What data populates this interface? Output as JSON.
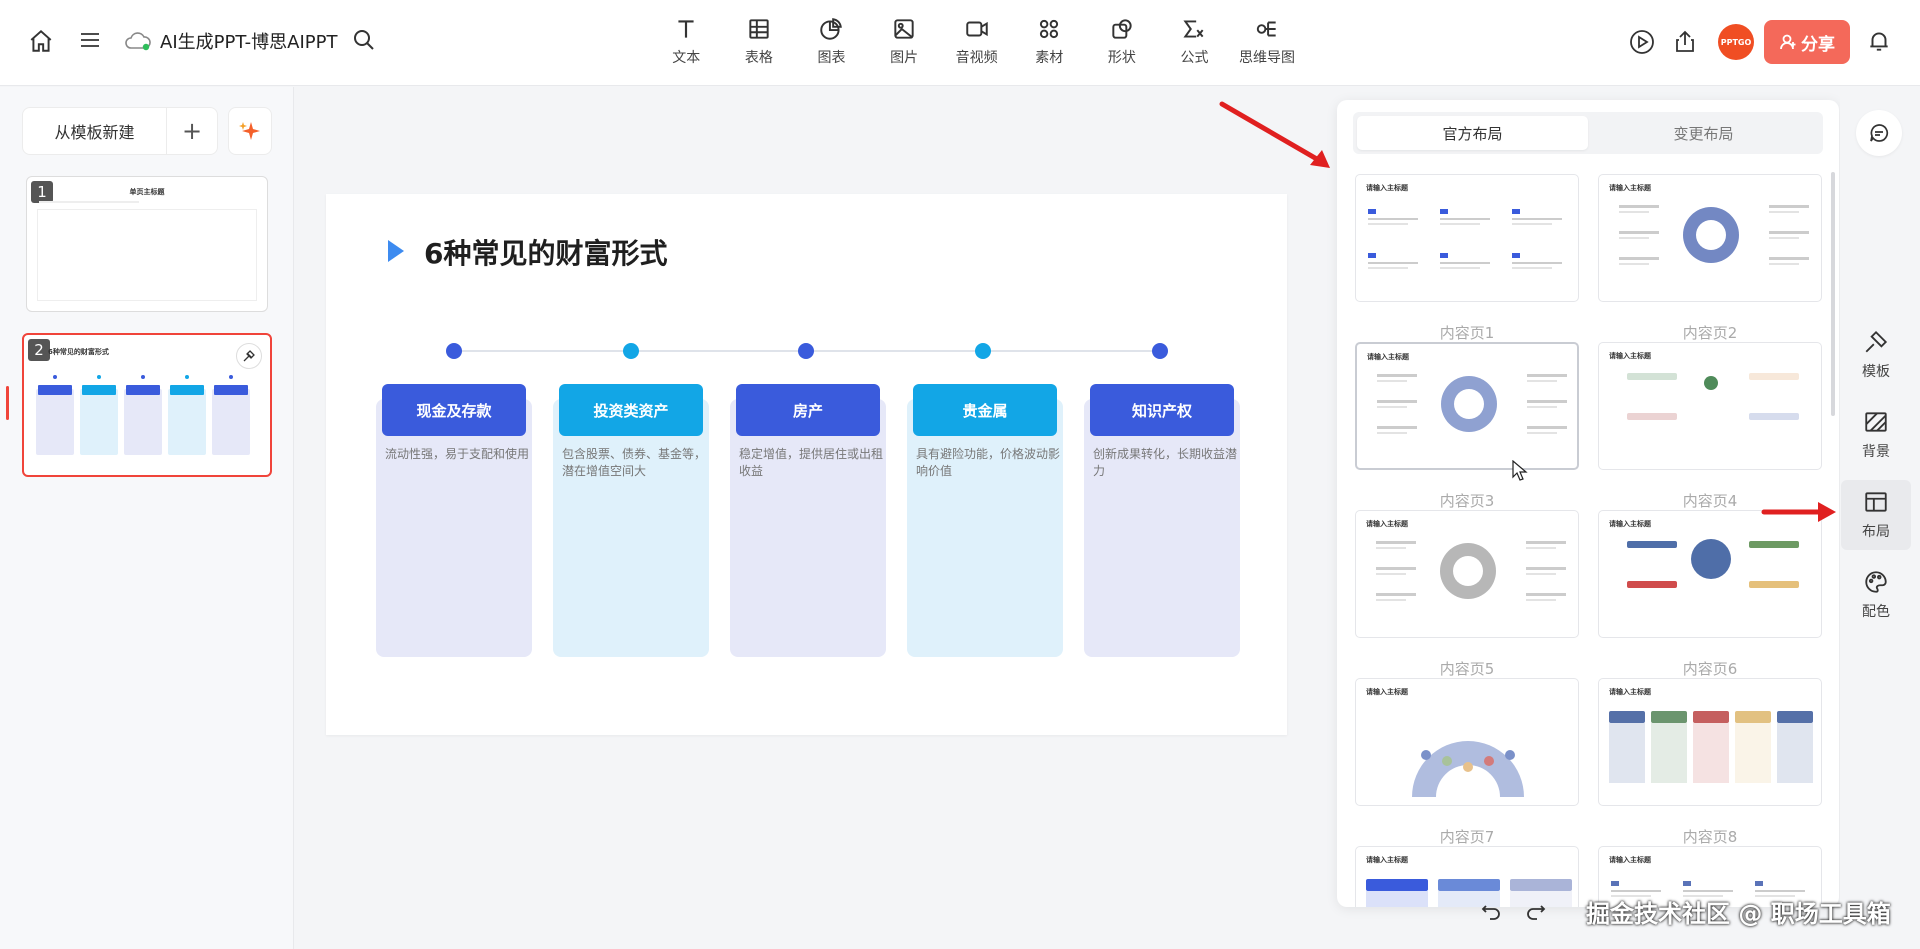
{
  "app": {
    "title": "AI生成PPT-博思AIPPT"
  },
  "toolbar": {
    "items": [
      {
        "label": "文本",
        "icon": "text-icon"
      },
      {
        "label": "表格",
        "icon": "table-icon"
      },
      {
        "label": "图表",
        "icon": "chart-icon"
      },
      {
        "label": "图片",
        "icon": "image-icon"
      },
      {
        "label": "音视频",
        "icon": "video-icon"
      },
      {
        "label": "素材",
        "icon": "material-icon"
      },
      {
        "label": "形状",
        "icon": "shape-icon"
      },
      {
        "label": "公式",
        "icon": "formula-icon"
      },
      {
        "label": "思维导图",
        "icon": "mindmap-icon"
      }
    ],
    "share_label": "分享",
    "avatar_text": "PPTGO"
  },
  "sidebar": {
    "new_from_template": "从模板新建",
    "plus": "+",
    "slides": [
      {
        "num": "1",
        "title": "单页主标题"
      },
      {
        "num": "2",
        "title": "6种常见的财富形式"
      }
    ]
  },
  "slide": {
    "title": "6种常见的财富形式",
    "accent": "#3d8bf0",
    "cards": [
      {
        "title": "现金及存款",
        "desc": "流动性强，易于支配和使用",
        "color": "#3a5bdc",
        "bg": "#e6e8f8"
      },
      {
        "title": "投资类资产",
        "desc": "包含股票、债券、基金等，潜在增值空间大",
        "color": "#12a6e6",
        "bg": "#dff1fb"
      },
      {
        "title": "房产",
        "desc": "稳定增值，提供居住或出租收益",
        "color": "#3a5bdc",
        "bg": "#e6e8f8"
      },
      {
        "title": "贵金属",
        "desc": "具有避险功能，价格波动影响价值",
        "color": "#12a6e6",
        "bg": "#dff1fb"
      },
      {
        "title": "知识产权",
        "desc": "创新成果转化，长期收益潜力",
        "color": "#3a5bdc",
        "bg": "#e6e8f8"
      }
    ]
  },
  "layout_panel": {
    "tabs": [
      "官方布局",
      "变更布局"
    ],
    "mini_title": "请输入主标题",
    "items": [
      "内容页1",
      "内容页2",
      "内容页3",
      "内容页4",
      "内容页5",
      "内容页6",
      "内容页7",
      "内容页8"
    ]
  },
  "rightbar": {
    "items": [
      {
        "label": "模板",
        "icon": "template-icon"
      },
      {
        "label": "背景",
        "icon": "background-icon"
      },
      {
        "label": "布局",
        "icon": "layout-icon"
      },
      {
        "label": "配色",
        "icon": "palette-icon"
      }
    ]
  },
  "watermark": "掘金技术社区 @ 职场工具箱"
}
